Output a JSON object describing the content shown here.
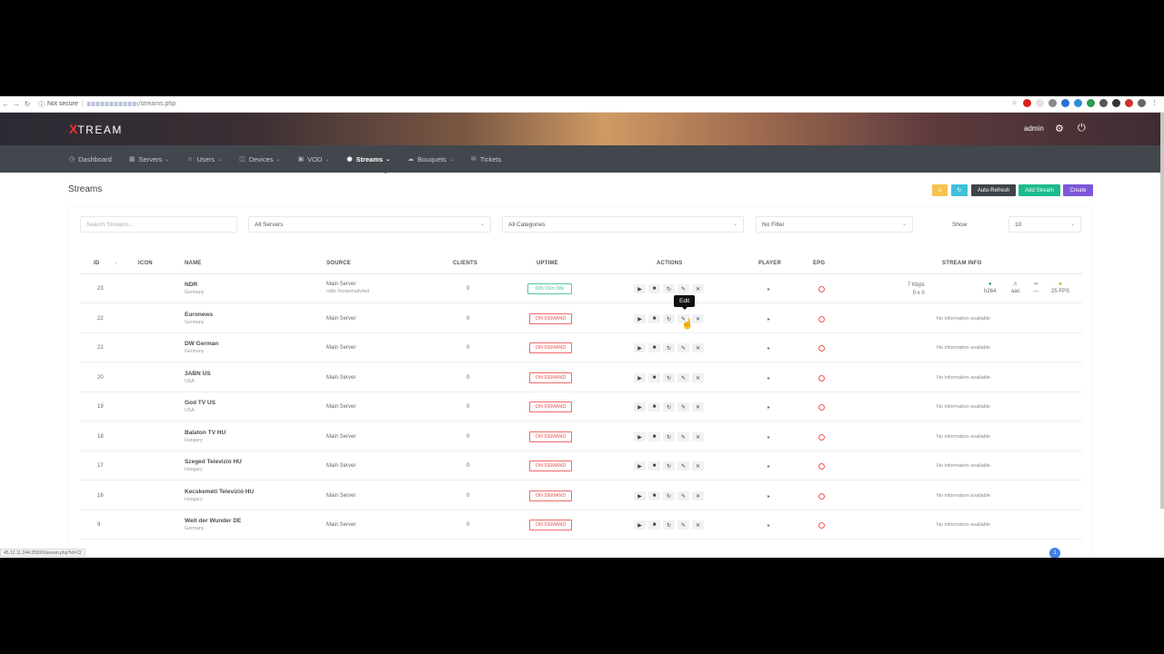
{
  "browser": {
    "security_label": "Not secure",
    "url_path": "/streams.php",
    "status_url": "45.12.11.244:25500/stream.php?id=22"
  },
  "app": {
    "logo_x": "X",
    "logo_rest": "TREAM",
    "user": "admin"
  },
  "nav": [
    {
      "label": "Dashboard",
      "icon": "dashboard-icon",
      "has_menu": false,
      "active": false
    },
    {
      "label": "Servers",
      "icon": "servers-icon",
      "has_menu": true,
      "active": false
    },
    {
      "label": "Users",
      "icon": "users-icon",
      "has_menu": true,
      "active": false
    },
    {
      "label": "Devices",
      "icon": "devices-icon",
      "has_menu": true,
      "active": false
    },
    {
      "label": "VOD",
      "icon": "vod-icon",
      "has_menu": true,
      "active": false
    },
    {
      "label": "Streams",
      "icon": "streams-icon",
      "has_menu": true,
      "active": true
    },
    {
      "label": "Bouquets",
      "icon": "bouquets-icon",
      "has_menu": true,
      "active": false
    },
    {
      "label": "Tickets",
      "icon": "tickets-icon",
      "has_menu": false,
      "active": false
    }
  ],
  "page": {
    "title": "Streams",
    "buttons": {
      "auto_refresh": "Auto-Refresh",
      "add_stream": "Add Stream",
      "create": "Create"
    }
  },
  "filters": {
    "search_placeholder": "Search Streams...",
    "servers": "All Servers",
    "categories": "All Categories",
    "filter": "No Filter",
    "show_label": "Show",
    "show_value": "10"
  },
  "table": {
    "headers": {
      "id": "ID",
      "icon": "ICON",
      "name": "NAME",
      "source": "SOURCE",
      "clients": "CLIENTS",
      "uptime": "UPTIME",
      "actions": "ACTIONS",
      "player": "PLAYER",
      "epg": "EPG",
      "stream_info": "STREAM INFO"
    },
    "rows": [
      {
        "id": "23",
        "name": "NDR",
        "country": "Germany",
        "source": "Main Server",
        "source_sub": "nditv  #solarmaltv4all",
        "clients": "0",
        "uptime": "00h 00m 08s",
        "uptime_ok": true,
        "info": "",
        "info_rich": true
      },
      {
        "id": "22",
        "name": "Euronews",
        "country": "Germany",
        "source": "Main Server",
        "source_sub": "",
        "clients": "0",
        "uptime": "ON DEMAND",
        "uptime_ok": false,
        "info": "No information available"
      },
      {
        "id": "21",
        "name": "DW German",
        "country": "Germany",
        "source": "Main Server",
        "source_sub": "",
        "clients": "0",
        "uptime": "ON DEMAND",
        "uptime_ok": false,
        "info": "No information available"
      },
      {
        "id": "20",
        "name": "3ABN US",
        "country": "USA",
        "source": "Main Server",
        "source_sub": "",
        "clients": "0",
        "uptime": "ON DEMAND",
        "uptime_ok": false,
        "info": "No information available"
      },
      {
        "id": "19",
        "name": "God TV US",
        "country": "USA",
        "source": "Main Server",
        "source_sub": "",
        "clients": "0",
        "uptime": "ON DEMAND",
        "uptime_ok": false,
        "info": "No information available"
      },
      {
        "id": "18",
        "name": "Balaton TV HU",
        "country": "Hungary",
        "source": "Main Server",
        "source_sub": "",
        "clients": "0",
        "uptime": "ON DEMAND",
        "uptime_ok": false,
        "info": "No information available"
      },
      {
        "id": "17",
        "name": "Szeged Televizió HU",
        "country": "Hungary",
        "source": "Main Server",
        "source_sub": "",
        "clients": "0",
        "uptime": "ON DEMAND",
        "uptime_ok": false,
        "info": "No information available"
      },
      {
        "id": "16",
        "name": "Kecskeméti Televízió HU",
        "country": "Hungary",
        "source": "Main Server",
        "source_sub": "",
        "clients": "0",
        "uptime": "ON DEMAND",
        "uptime_ok": false,
        "info": "No information available"
      },
      {
        "id": "9",
        "name": "Welt der Wunder DE",
        "country": "Germany",
        "source": "Main Server",
        "source_sub": "",
        "clients": "0",
        "uptime": "ON DEMAND",
        "uptime_ok": false,
        "info": "No information available"
      }
    ],
    "first_row_info": {
      "bitrate": "7 Kbps",
      "resolution": "0 x 0",
      "video_codec": "h264",
      "audio_codec": "aac",
      "extra": "---",
      "fps": "25 FPS"
    }
  },
  "tooltip": "Edit",
  "pagination": {
    "current": "1"
  },
  "colors": {
    "nav_bg": "#42474d",
    "auto_refresh_bg": "#3f444a",
    "add_stream_bg": "#1cbb8c",
    "create_bg": "#7d57d9",
    "warning_bg": "#f5c351",
    "info_bg": "#3ec1d9"
  }
}
